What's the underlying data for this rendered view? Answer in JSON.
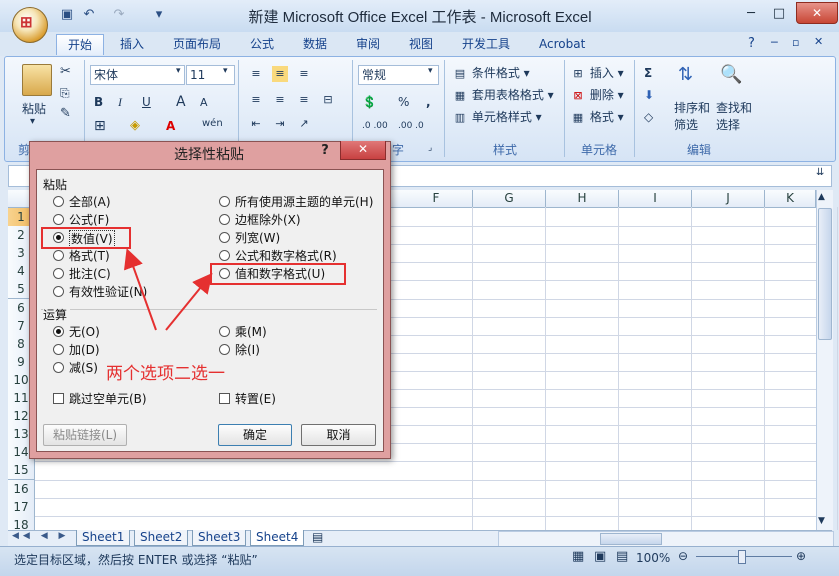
{
  "window": {
    "title": "新建 Microsoft Office Excel 工作表 - Microsoft Excel"
  },
  "tabs": [
    "开始",
    "插入",
    "页面布局",
    "公式",
    "数据",
    "审阅",
    "视图",
    "开发工具",
    "Acrobat"
  ],
  "ribbon": {
    "clipboard": {
      "paste": "粘贴",
      "label": "剪"
    },
    "font": {
      "name": "宋体",
      "size": "11",
      "bold": "B",
      "italic": "I",
      "underline": "U",
      "grow": "A",
      "shrink": "A",
      "font_color": "A",
      "phonetic": "wén"
    },
    "number": {
      "format": "常规",
      "percent": "%",
      "comma": ",",
      "inc_dec": ".0 .00",
      "dec_dec": ".00 .0",
      "label": "字"
    },
    "styles": {
      "conditional": "条件格式",
      "table": "套用表格格式",
      "cell_styles": "单元格样式",
      "label": "样式"
    },
    "cells": {
      "insert": "插入",
      "delete": "删除",
      "format": "格式",
      "label": "单元格"
    },
    "editing": {
      "sum": "Σ",
      "sort": "排序和",
      "sort2": "筛选",
      "find": "查找和",
      "find2": "选择",
      "label": "编辑"
    }
  },
  "grid": {
    "columns": [
      "F",
      "G",
      "H",
      "I",
      "J",
      "K"
    ],
    "rows": [
      "1",
      "2",
      "3",
      "4",
      "5",
      "6",
      "7",
      "8",
      "9",
      "10",
      "11",
      "12",
      "13",
      "14",
      "15",
      "16",
      "17",
      "18"
    ]
  },
  "sheets": [
    "Sheet1",
    "Sheet2",
    "Sheet3",
    "Sheet4"
  ],
  "statusbar": {
    "text": "选定目标区域，然后按 ENTER 或选择 “粘贴”",
    "zoom": "100%"
  },
  "dialog": {
    "title": "选择性粘贴",
    "help": "?",
    "close": "✕",
    "paste_label": "粘贴",
    "paste_left": [
      "全部(A)",
      "公式(F)",
      "数值(V)",
      "格式(T)",
      "批注(C)",
      "有效性验证(N)"
    ],
    "paste_right": [
      "所有使用源主题的单元(H)",
      "边框除外(X)",
      "列宽(W)",
      "公式和数字格式(R)",
      "值和数字格式(U)"
    ],
    "op_label": "运算",
    "op_left": [
      "无(O)",
      "加(D)",
      "减(S)"
    ],
    "op_right": [
      "乘(M)",
      "除(I)"
    ],
    "skip_blanks": "跳过空单元(B)",
    "transpose": "转置(E)",
    "paste_link": "粘贴链接(L)",
    "ok": "确定",
    "cancel": "取消"
  },
  "annotation": "两个选项二选一",
  "colors": {
    "highlight": "#e53030",
    "dialog_frame": "#dfa0a0"
  }
}
